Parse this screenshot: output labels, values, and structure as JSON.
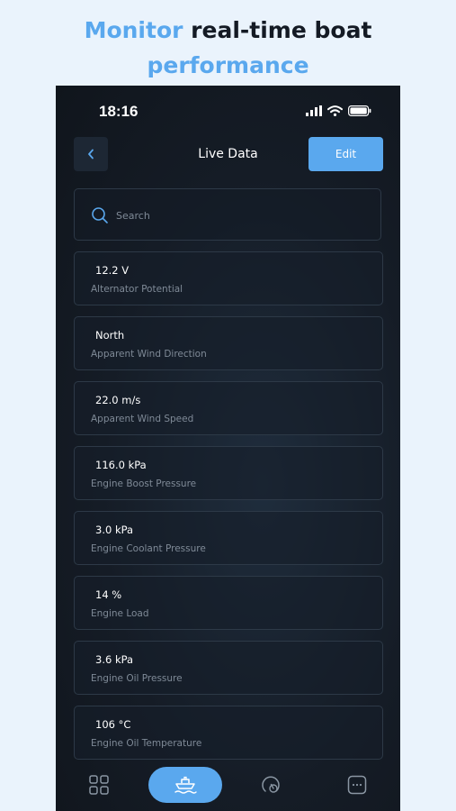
{
  "headline": {
    "part1": "Monitor",
    "part2": " real-time boat",
    "part3": "performance"
  },
  "status_bar": {
    "time": "18:16"
  },
  "nav": {
    "title": "Live Data",
    "edit_label": "Edit",
    "back_icon": "chevron-left-icon"
  },
  "search": {
    "placeholder": "Search",
    "value": ""
  },
  "items": [
    {
      "value": "12.2 V",
      "label": "Alternator Potential"
    },
    {
      "value": "North",
      "label": "Apparent Wind Direction"
    },
    {
      "value": "22.0 m/s",
      "label": "Apparent Wind Speed"
    },
    {
      "value": "116.0 kPa",
      "label": "Engine Boost Pressure"
    },
    {
      "value": "3.0 kPa",
      "label": "Engine Coolant Pressure"
    },
    {
      "value": "14 %",
      "label": "Engine Load"
    },
    {
      "value": "3.6 kPa",
      "label": "Engine Oil Pressure"
    },
    {
      "value": "106 °C",
      "label": "Engine Oil Temperature"
    }
  ],
  "tabbar": {
    "tabs": [
      "grid-icon",
      "boat-icon",
      "speedometer-icon",
      "more-icon"
    ],
    "active": 1
  },
  "colors": {
    "accent": "#5aa8ee",
    "page_background": "#eaf3fc",
    "app_background": "#151c26",
    "card_border": "#2d3947",
    "secondary_text": "#7f8a97"
  }
}
